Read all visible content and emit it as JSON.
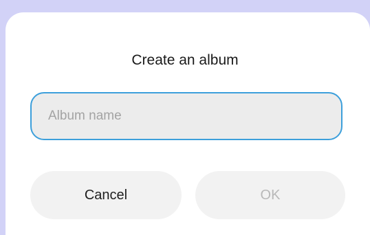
{
  "dialog": {
    "title": "Create an album",
    "album_name_input": {
      "value": "",
      "placeholder": "Album name"
    },
    "cancel_label": "Cancel",
    "ok_label": "OK"
  },
  "colors": {
    "backdrop": "#d2d2f7",
    "accent": "#3c9fdb",
    "disabled_text": "#b8b8b8"
  }
}
